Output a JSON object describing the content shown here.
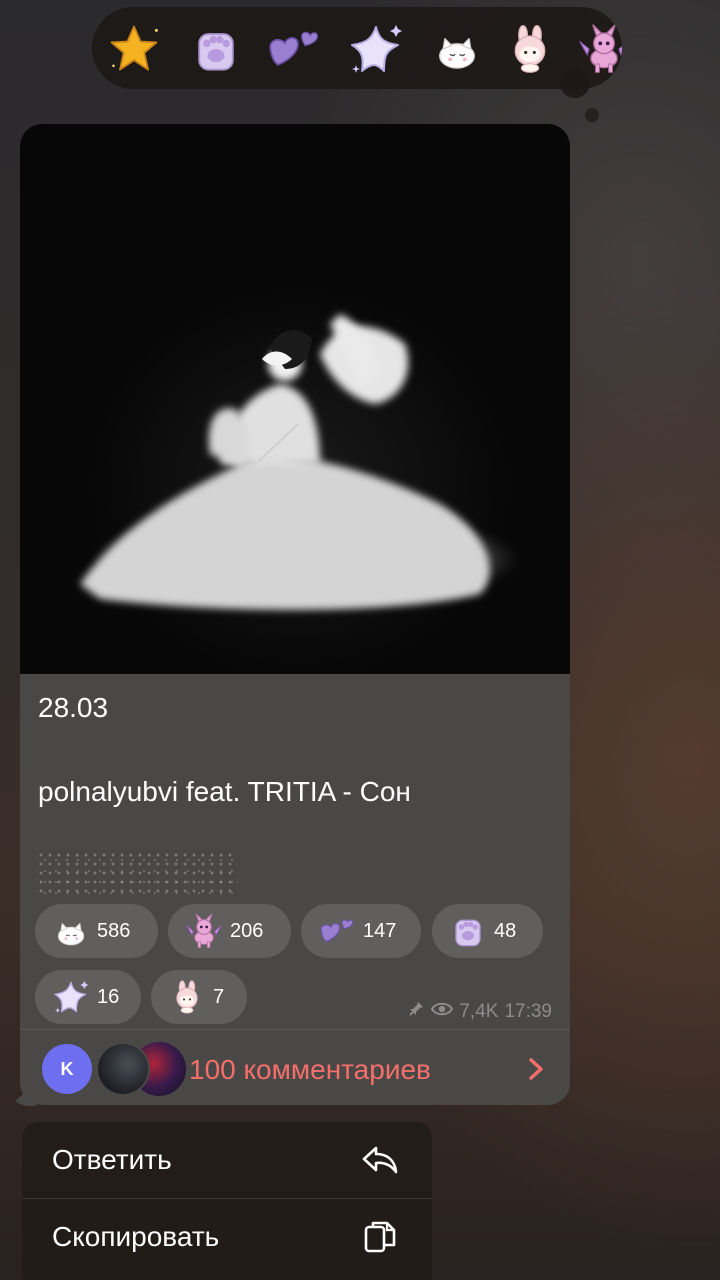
{
  "picker": {
    "emojis": [
      "star",
      "paw",
      "heart",
      "sparkle-star",
      "cat",
      "bunny",
      "pony"
    ]
  },
  "post": {
    "date_text": "28.03",
    "track_text": "polnalyubvi feat. TRITIA - Сон",
    "reactions": [
      {
        "icon": "cat",
        "count": "586"
      },
      {
        "icon": "pony",
        "count": "206"
      },
      {
        "icon": "heart",
        "count": "147"
      },
      {
        "icon": "paw",
        "count": "48"
      },
      {
        "icon": "sparkle-star",
        "count": "16"
      },
      {
        "icon": "bunny",
        "count": "7"
      }
    ],
    "views": "7,4K",
    "time": "17:39",
    "comments": {
      "avatar_letter": "K",
      "label": "100 комментариев"
    }
  },
  "menu": {
    "reply_label": "Ответить",
    "copy_label": "Скопировать"
  },
  "colors": {
    "accent": "#f56f6a",
    "bubble": "#4a4847",
    "avatar_blue": "#6d6ef0"
  }
}
